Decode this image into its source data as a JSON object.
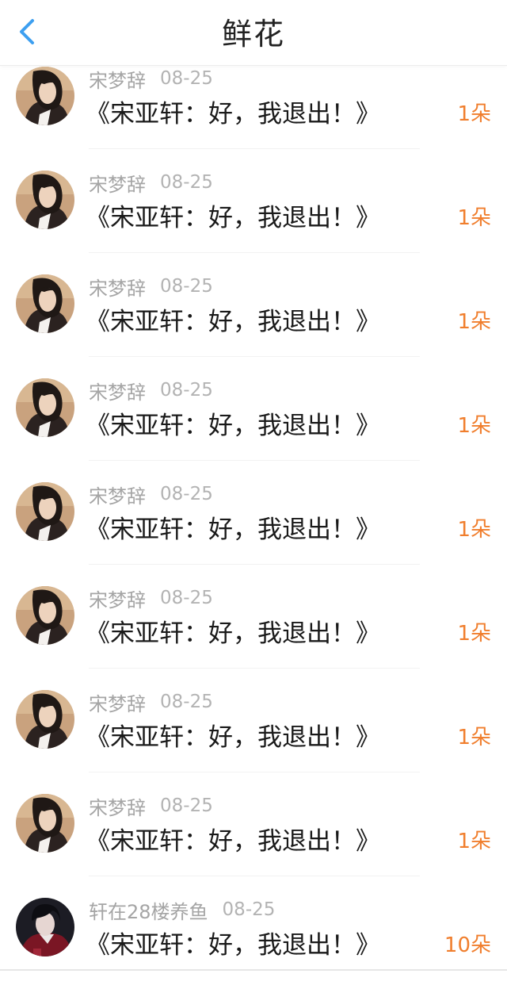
{
  "header": {
    "title": "鲜花",
    "back_icon": "chevron-left-icon",
    "accent_color": "#3d9ff0"
  },
  "count_color": "#f07e2d",
  "items": [
    {
      "user": "宋梦辞",
      "date": "08-25",
      "title": "《宋亚轩：好，我退出！》",
      "count": "1朵",
      "avatar": "female-avatar"
    },
    {
      "user": "宋梦辞",
      "date": "08-25",
      "title": "《宋亚轩：好，我退出！》",
      "count": "1朵",
      "avatar": "female-avatar"
    },
    {
      "user": "宋梦辞",
      "date": "08-25",
      "title": "《宋亚轩：好，我退出！》",
      "count": "1朵",
      "avatar": "female-avatar"
    },
    {
      "user": "宋梦辞",
      "date": "08-25",
      "title": "《宋亚轩：好，我退出！》",
      "count": "1朵",
      "avatar": "female-avatar"
    },
    {
      "user": "宋梦辞",
      "date": "08-25",
      "title": "《宋亚轩：好，我退出！》",
      "count": "1朵",
      "avatar": "female-avatar"
    },
    {
      "user": "宋梦辞",
      "date": "08-25",
      "title": "《宋亚轩：好，我退出！》",
      "count": "1朵",
      "avatar": "female-avatar"
    },
    {
      "user": "宋梦辞",
      "date": "08-25",
      "title": "《宋亚轩：好，我退出！》",
      "count": "1朵",
      "avatar": "female-avatar"
    },
    {
      "user": "宋梦辞",
      "date": "08-25",
      "title": "《宋亚轩：好，我退出！》",
      "count": "1朵",
      "avatar": "female-avatar"
    },
    {
      "user": "轩在28楼养鱼",
      "date": "08-25",
      "title": "《宋亚轩：好，我退出！》",
      "count": "10朵",
      "avatar": "male-avatar"
    }
  ]
}
